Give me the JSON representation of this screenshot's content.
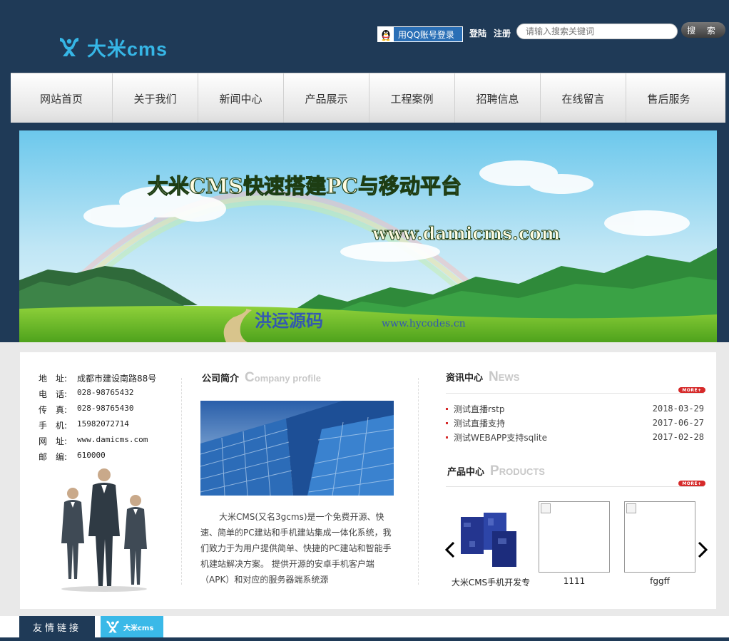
{
  "header": {
    "logo_text": "大米cms",
    "qq_login": "用QQ账号登录",
    "login": "登陆",
    "register": "注册",
    "search_placeholder": "请输入搜索关键词",
    "search_button": "搜 索"
  },
  "nav": {
    "items": [
      "网站首页",
      "关于我们",
      "新闻中心",
      "产品展示",
      "工程案例",
      "招聘信息",
      "在线留言",
      "售后服务"
    ]
  },
  "banner": {
    "headline": "大米CMS快速搭建PC与移动平台",
    "url": "www.damicms.com",
    "watermark_cn": "洪运源码",
    "watermark_url": "www.hycodes.cn"
  },
  "contact": {
    "rows": [
      {
        "k": "地　址:",
        "v": "成都市建设南路88号"
      },
      {
        "k": "电　话:",
        "v": "028-98765432"
      },
      {
        "k": "传　真:",
        "v": "028-98765430"
      },
      {
        "k": "手　机:",
        "v": "15982072714"
      },
      {
        "k": "网　址:",
        "v": "www.damicms.com"
      },
      {
        "k": "邮　编:",
        "v": "610000"
      }
    ]
  },
  "company": {
    "title_cn": "公司简介",
    "title_en_first": "C",
    "title_en_rest": "ompany profile",
    "text": "大米CMS(又名3gcms)是一个免费开源、快速、简单的PC建站和手机建站集成一体化系统，我们致力于为用户提供简单、快捷的PC建站和智能手机建站解决方案。 提供开源的安卓手机客户端（APK）和对应的服务器端系统源"
  },
  "news": {
    "title_cn": "资讯中心",
    "title_en_first": "N",
    "title_en_rest": "EWS",
    "more": "MORE+",
    "items": [
      {
        "title": "测试直播rstp",
        "date": "2018-03-29"
      },
      {
        "title": "测试直播支持",
        "date": "2017-06-27"
      },
      {
        "title": "测试WEBAPP支持sqlite",
        "date": "2017-02-28"
      }
    ]
  },
  "products": {
    "title_cn": "产品中心",
    "title_en_first": "P",
    "title_en_rest": "RODUCTS",
    "more": "MORE+",
    "items": [
      {
        "label": "大米CMS手机开发专"
      },
      {
        "label": "1111"
      },
      {
        "label": "fggff"
      }
    ]
  },
  "footer": {
    "friends_label": "友情链接",
    "friend_logo_text": "大米cms"
  },
  "colors": {
    "navy": "#1f3a57",
    "brand_blue": "#36b6e6",
    "accent_red": "#d62a2a"
  }
}
